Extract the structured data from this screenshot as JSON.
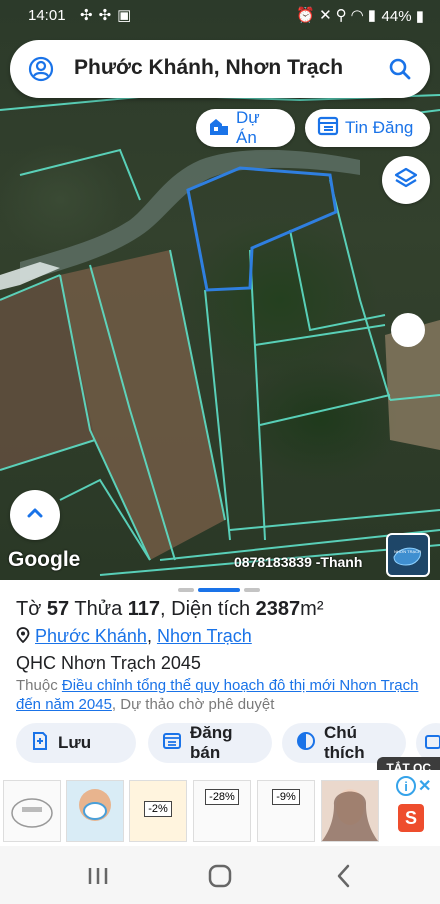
{
  "status_bar": {
    "time": "14:01",
    "left_icons": [
      "pinwheel-icon",
      "pinwheel-icon",
      "image-icon"
    ],
    "right_icons": [
      "alarm-icon",
      "mute-icon",
      "location-icon",
      "wifi-icon",
      "signal-icon"
    ],
    "battery": "44%"
  },
  "search": {
    "title": "Phước Khánh, Nhơn Trạch"
  },
  "map_buttons": {
    "du_an": "Dự Án",
    "tin_dang": "Tin Đăng"
  },
  "map": {
    "attribution": "Google",
    "phone_label": "0878183839 -Thanh",
    "thumbnail_text": "NHƠN TRẠCH"
  },
  "parcel": {
    "to_label": "Tờ",
    "to_value": "57",
    "thua_label": "Thửa",
    "thua_value": "117",
    "dien_tich_label": ", Diện tích",
    "dien_tich_value": "2387",
    "unit": "m²"
  },
  "location": {
    "ward": "Phước Khánh",
    "separator": ", ",
    "district": "Nhơn Trạch"
  },
  "planning": {
    "qhc_title": "QHC Nhơn Trạch 2045",
    "thuoc_label": "Thuộc",
    "plan_link": "Điều chỉnh tổng thể quy hoạch đô thị mới Nhơn Trạch đến năm 2045",
    "status": ", Dự thảo chờ phê duyệt"
  },
  "actions": {
    "save": "Lưu",
    "post": "Đăng bán",
    "legend": "Chú thích"
  },
  "ads": {
    "close_label": "TẮT QC",
    "badges": [
      "-2%",
      "-28%",
      "-9%"
    ],
    "brand_label": "S"
  },
  "colors": {
    "accent": "#1a73e8",
    "parcel_outline": "#2f7fe0",
    "boundary_lines": "#5ee0c8",
    "ad_brand": "#ee4d2d"
  }
}
